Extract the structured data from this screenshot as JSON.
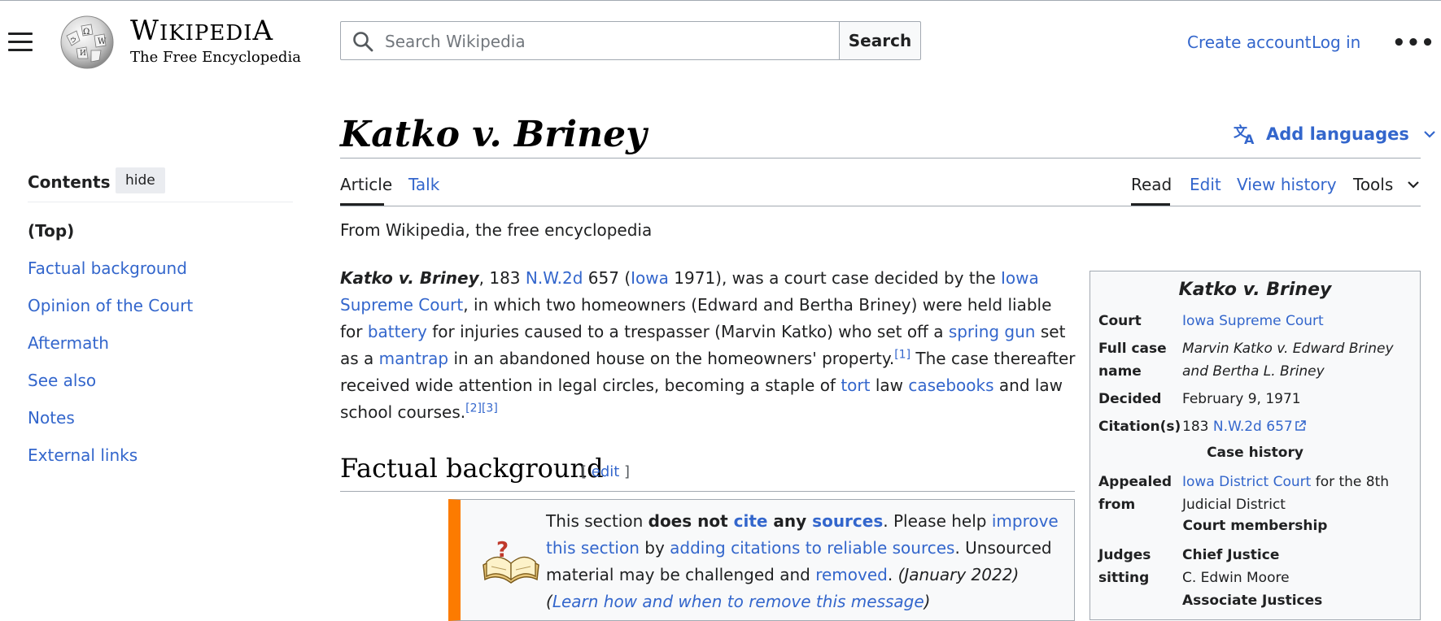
{
  "header": {
    "logo_name_first": "W",
    "logo_name_rest_a": "IKIPEDI",
    "logo_name_last": "A",
    "logo_tagline": "The Free Encyclopedia",
    "search_placeholder": "Search Wikipedia",
    "search_button": "Search",
    "create_account": "Create account",
    "log_in": "Log in",
    "more": "•••"
  },
  "page": {
    "title": "Katko v. Briney",
    "add_languages": "Add languages",
    "tabs": {
      "article": "Article",
      "talk": "Talk",
      "read": "Read",
      "edit": "Edit",
      "view_history": "View history",
      "tools": "Tools"
    },
    "tagline": "From Wikipedia, the free encyclopedia"
  },
  "toc": {
    "title": "Contents",
    "hide": "hide",
    "items": [
      "(Top)",
      "Factual background",
      "Opinion of the Court",
      "Aftermath",
      "See also",
      "Notes",
      "External links"
    ]
  },
  "lead": {
    "title_italic": "Katko v. Briney",
    "t1": ", 183 ",
    "l_nw2d": "N.W.2d",
    "t2": " 657 (",
    "l_iowa": "Iowa",
    "t3": " 1971), was a court case decided by the ",
    "l_iowa_sc": "Iowa Supreme Court",
    "t4": ", in which two homeowners (Edward and Bertha Briney) were held liable for ",
    "l_battery": "battery",
    "t5": " for injuries caused to a trespasser (Marvin Katko) who set off a ",
    "l_spring_gun": "spring gun",
    "t6": " set as a ",
    "l_mantrap": "mantrap",
    "t7": " in an abandoned house on the homeowners' property.",
    "ref1": "[1]",
    "t8": " The case thereafter received wide attention in legal circles, becoming a staple of ",
    "l_tort": "tort",
    "t9": " law ",
    "l_casebooks": "casebooks",
    "t10": " and law school courses.",
    "ref2": "[2]",
    "ref3": "[3]"
  },
  "section": {
    "heading": "Factual background",
    "edit_open": "[ ",
    "edit": "edit",
    "edit_close": " ]"
  },
  "ambox": {
    "t1": "This section ",
    "b1": "does not ",
    "l_cite": "cite",
    "b2": " any ",
    "l_sources": "sources",
    "t2": ". Please help ",
    "l_improve": "improve this section",
    "t3": " by ",
    "l_adding": "adding citations to reliable sources",
    "t4": ". Unsourced material may be challenged and ",
    "l_removed": "removed",
    "t5": ". ",
    "date": "(January 2022)",
    "t6": " (",
    "l_learn": "Learn how and when to remove this message",
    "t7": ")"
  },
  "infobox": {
    "caption": "Katko v. Briney",
    "court_label": "Court",
    "court_value": "Iowa Supreme Court",
    "fullname_label": "Full case name",
    "fullname_value": "Marvin Katko v. Edward Briney and Bertha L. Briney",
    "decided_label": "Decided",
    "decided_value": "February 9, 1971",
    "citation_label": "Citation(s)",
    "citation_prefix": "183 ",
    "citation_link": "N.W.2d 657",
    "case_history": "Case history",
    "appealed_label": "Appealed from",
    "appealed_link": "Iowa District Court",
    "appealed_rest": " for the 8th Judicial District",
    "court_membership": "Court membership",
    "judges_label": "Judges sitting",
    "chief_justice_label": "Chief Justice",
    "chief_justice": "C. Edwin Moore",
    "associate_justices": "Associate Justices"
  },
  "colors": {
    "link": "#3366cc",
    "ambox_bar": "#fc7b00",
    "text": "#202122"
  }
}
